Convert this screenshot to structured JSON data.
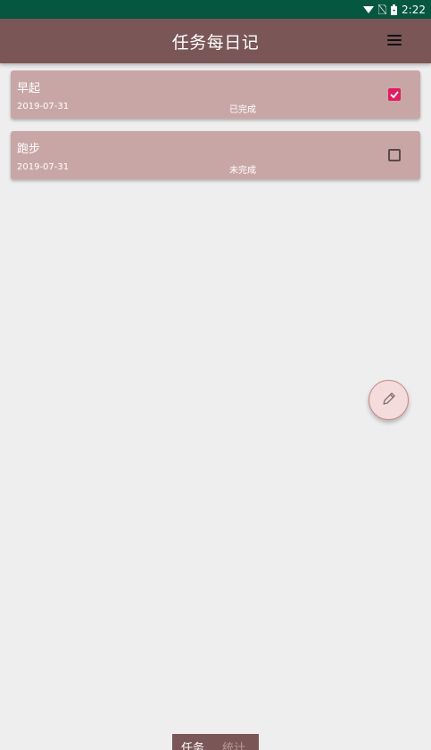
{
  "status_bar": {
    "time": "2:22",
    "icons": [
      "wifi-icon",
      "no-sim-icon",
      "battery-icon"
    ]
  },
  "app_bar": {
    "title": "任务每日记",
    "menu_icon": "menu-icon"
  },
  "tasks": [
    {
      "name": "早起",
      "date": "2019-07-31",
      "status": "已完成",
      "checked": true
    },
    {
      "name": "跑步",
      "date": "2019-07-31",
      "status": "未完成",
      "checked": false
    }
  ],
  "fab": {
    "icon": "pencil-icon"
  },
  "bottom_tabs": [
    {
      "label": "任务",
      "active": true
    },
    {
      "label": "统计",
      "active": false
    }
  ],
  "colors": {
    "status_bar": "#06573f",
    "app_bar": "#7a5656",
    "card": "#c9a6a6",
    "check_accent": "#e11d62",
    "background": "#eeeeee"
  }
}
